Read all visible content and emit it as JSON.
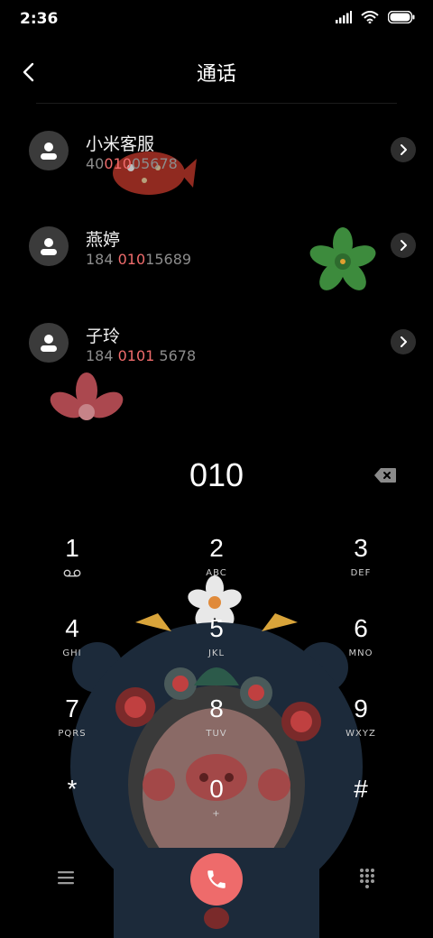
{
  "status_bar": {
    "time": "2:36",
    "icons": [
      "signal-icon",
      "wifi-icon",
      "battery-icon"
    ]
  },
  "header": {
    "title": "通话",
    "back_icon": "back-arrow-icon"
  },
  "contacts": [
    {
      "name": "小米客服",
      "num_pre": "40",
      "num_match": "010",
      "num_post": "05678"
    },
    {
      "name": "燕婷",
      "num_pre": "184 ",
      "num_match": "010",
      "num_post": "15689"
    },
    {
      "name": "子玲",
      "num_pre": "184 ",
      "num_match": "0101",
      "num_post": " 5678"
    }
  ],
  "dialer": {
    "input_value": "010",
    "backspace_icon": "backspace-icon"
  },
  "keypad": {
    "keys": [
      {
        "digit": "1",
        "letters": ""
      },
      {
        "digit": "2",
        "letters": "ABC"
      },
      {
        "digit": "3",
        "letters": "DEF"
      },
      {
        "digit": "4",
        "letters": "GHI"
      },
      {
        "digit": "5",
        "letters": "JKL"
      },
      {
        "digit": "6",
        "letters": "MNO"
      },
      {
        "digit": "7",
        "letters": "PQRS"
      },
      {
        "digit": "8",
        "letters": "TUV"
      },
      {
        "digit": "9",
        "letters": "WXYZ"
      },
      {
        "digit": "*",
        "letters": ""
      },
      {
        "digit": "0",
        "letters": "+"
      },
      {
        "digit": "#",
        "letters": ""
      }
    ]
  },
  "bottom_bar": {
    "menu_icon": "menu-icon",
    "call_icon": "phone-icon",
    "keypad_icon": "dialpad-icon"
  },
  "colors": {
    "accent": "#ee6b6b",
    "highlight": "#f06c6c",
    "background": "#000000"
  }
}
